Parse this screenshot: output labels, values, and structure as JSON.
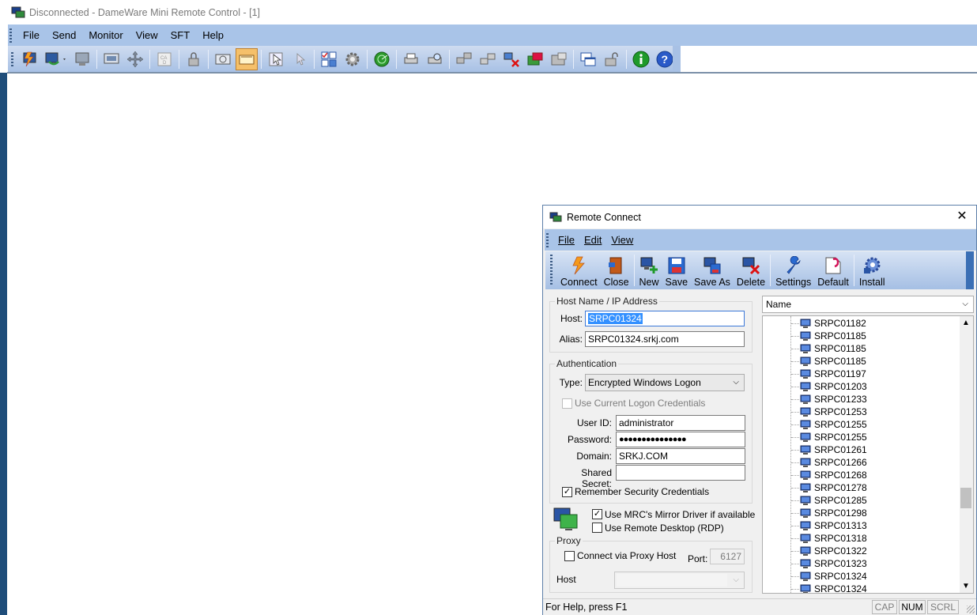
{
  "main": {
    "title": "Disconnected - DameWare Mini Remote Control - [1]",
    "menu": [
      "File",
      "Send",
      "Monitor",
      "View",
      "SFT",
      "Help"
    ]
  },
  "dialog": {
    "title": "Remote Connect",
    "close_glyph": "✕",
    "menu": [
      "File",
      "Edit",
      "View"
    ],
    "toolbar": {
      "connect": "Connect",
      "close": "Close",
      "new": "New",
      "save": "Save",
      "save_as": "Save As",
      "delete": "Delete",
      "settings": "Settings",
      "default": "Default",
      "install": "Install"
    },
    "host_group": {
      "legend": "Host Name / IP Address",
      "host_label": "Host:",
      "host_value": "SRPC01324",
      "alias_label": "Alias:",
      "alias_value": "SRPC01324.srkj.com"
    },
    "auth_group": {
      "legend": "Authentication",
      "type_label": "Type:",
      "type_value": "Encrypted Windows Logon",
      "use_current_label": "Use Current Logon Credentials",
      "userid_label": "User ID:",
      "userid_value": "administrator",
      "password_label": "Password:",
      "password_value": "●●●●●●●●●●●●●●●",
      "domain_label": "Domain:",
      "domain_value": "SRKJ.COM",
      "shared_label": "Shared Secret:",
      "shared_value": "",
      "remember_label": "Remember Security Credentials",
      "remember_checked": "✓"
    },
    "options": {
      "mirror_label": "Use MRC's Mirror Driver if available",
      "mirror_checked": "✓",
      "rdp_label": "Use Remote Desktop (RDP)"
    },
    "proxy_group": {
      "legend": "Proxy",
      "via_label": "Connect via Proxy Host",
      "port_label": "Port:",
      "port_value": "6127",
      "host_label": "Host"
    },
    "tree_header": "Name",
    "hosts": [
      "SRPC01182",
      "SRPC01185",
      "SRPC01185",
      "SRPC01185",
      "SRPC01197",
      "SRPC01203",
      "SRPC01233",
      "SRPC01253",
      "SRPC01255",
      "SRPC01255",
      "SRPC01261",
      "SRPC01266",
      "SRPC01268",
      "SRPC01278",
      "SRPC01285",
      "SRPC01298",
      "SRPC01313",
      "SRPC01318",
      "SRPC01322",
      "SRPC01323",
      "SRPC01324",
      "SRPC01324"
    ],
    "status": {
      "help": "For Help, press F1",
      "cap": "CAP",
      "num": "NUM",
      "scrl": "SCRL"
    }
  },
  "colors": {
    "menubar": "#a9c4e8",
    "toolbar_active": "#f5c06a"
  }
}
